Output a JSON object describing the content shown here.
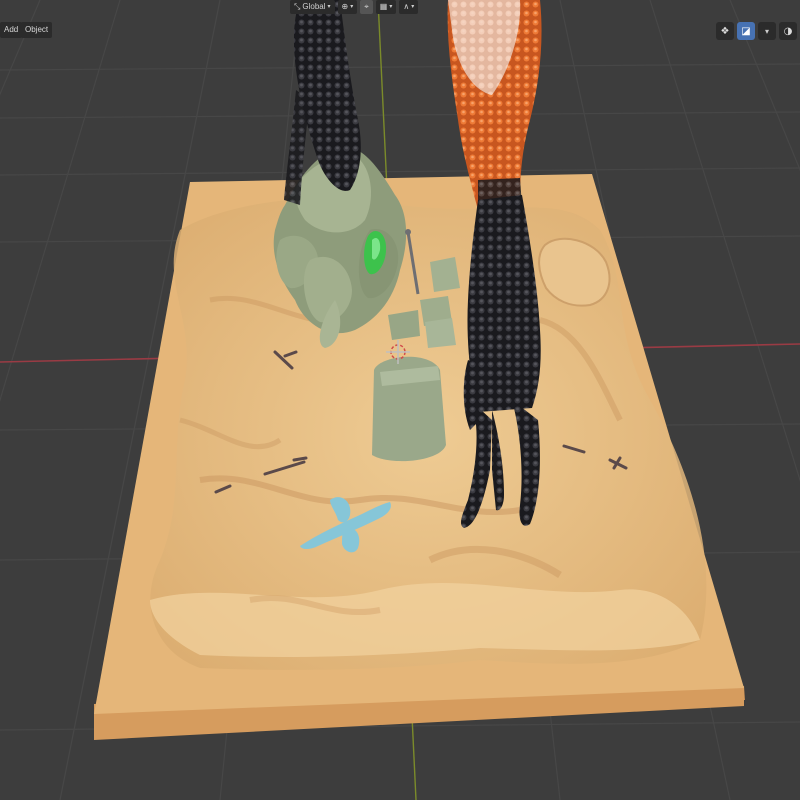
{
  "header": {
    "add_label": "Add",
    "object_label": "Object"
  },
  "toolbar": {
    "orientation_label": "Global",
    "icons": [
      "transform-orientation-icon",
      "pivot-icon",
      "snap-icon",
      "proportional-edit-icon"
    ]
  },
  "viewport": {
    "right_icons": [
      "gizmo-icon",
      "overlay-icon",
      "xray-icon",
      "shading-icon"
    ]
  },
  "colors": {
    "background": "#3d3d3d",
    "sand": "#e2b77d",
    "rock": "#9aa98a",
    "crystal": "#39c24a",
    "bone": "#86c6d8",
    "tail_black": "#1b1b1e",
    "tail_orange": "#e0652a",
    "accent": "#4772b3"
  }
}
